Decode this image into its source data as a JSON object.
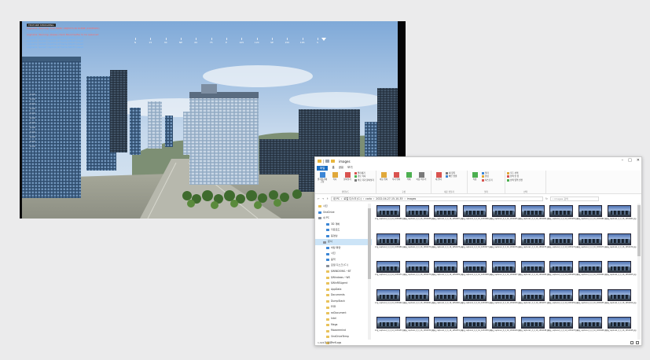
{
  "simulator": {
    "log_header": "TEXTURE STREAMING",
    "log_lines": [
      {
        "text": "LogCarla: Warning: TOO MANY OBJECTS IN SCENE (COMPLEX)",
        "type": "warn"
      },
      {
        "text": "LogRenderer: Grid dataset cache count: 512 (textures 24)",
        "type": "info"
      },
      {
        "text": "LogCarla: Warning: please check Blend buffer to be spawned",
        "type": "warn"
      },
      {
        "text": "LogCarla: Sensor capture at frame 18431 saved",
        "type": "info"
      },
      {
        "text": "LogCarla: Sensor capture at frame 18432 saved",
        "type": "info"
      },
      {
        "text": "LogCarla: Sensor capture at frame 18433 saved",
        "type": "info"
      },
      {
        "text": "LogCarla: Sensor capture at frame 18434 saved",
        "type": "info"
      }
    ],
    "compass_labels": [
      "N",
      "15",
      "30",
      "NE",
      "60",
      "75",
      "E",
      "105",
      "120",
      "SE",
      "150",
      "165",
      "S"
    ],
    "side_values": [
      "0.00",
      "0.00",
      "0.00",
      "0.00",
      "0.00",
      "0.00",
      "0.00",
      "0.00",
      "0.00",
      "0.00",
      "0.00",
      "0.00"
    ],
    "colors": {
      "sky_top": "#7fa9d8",
      "sky_bottom": "#dce8f2",
      "ground": "#8d8f83"
    }
  },
  "explorer": {
    "title": "images",
    "window_controls": [
      "–",
      "□",
      "✕"
    ],
    "ribbon_tabs": [
      "파일",
      "홈",
      "공유",
      "보기"
    ],
    "ribbon_groups": [
      {
        "label": "클립보드",
        "buttons": [
          "즐겨찾기에 고정",
          "복사",
          "붙여넣기"
        ],
        "small": [
          "잘라내기",
          "경로 복사",
          "바로 가기 붙여넣기"
        ]
      },
      {
        "label": "구성",
        "buttons": [
          "이동 위치",
          "복사 위치",
          "삭제",
          "이름 바꾸기"
        ],
        "small": []
      },
      {
        "label": "새로 만들기",
        "buttons": [
          "새 폴더"
        ],
        "small": [
          "새 항목",
          "빠른 연결"
        ]
      },
      {
        "label": "열기",
        "buttons": [
          "속성"
        ],
        "small": [
          "열기",
          "편집",
          "히스토리"
        ]
      },
      {
        "label": "선택",
        "buttons": [],
        "small": [
          "모두 선택",
          "선택 안 함",
          "선택 영역 반전"
        ]
      }
    ],
    "address": {
      "path": [
        "내 PC",
        "로컬 디스크 (C:)",
        "carla",
        "2022-04-27-15-10-33",
        "images"
      ],
      "search_placeholder": "images 검색"
    },
    "nav_items": [
      {
        "label": "사진",
        "icon": "folder",
        "indent": false,
        "selected": false
      },
      {
        "label": "OneDrive",
        "icon": "blue",
        "indent": false,
        "selected": false
      },
      {
        "label": "내 PC",
        "icon": "gray",
        "indent": false,
        "selected": false
      },
      {
        "label": "3D 개체",
        "icon": "blue",
        "indent": true,
        "selected": false
      },
      {
        "label": "다운로드",
        "icon": "blue",
        "indent": true,
        "selected": false
      },
      {
        "label": "동영상",
        "icon": "blue",
        "indent": true,
        "selected": false
      },
      {
        "label": "문서",
        "icon": "gray",
        "indent": true,
        "selected": true
      },
      {
        "label": "바탕 화면",
        "icon": "blue",
        "indent": true,
        "selected": false
      },
      {
        "label": "사진",
        "icon": "blue",
        "indent": true,
        "selected": false
      },
      {
        "label": "음악",
        "icon": "blue",
        "indent": true,
        "selected": false
      },
      {
        "label": "로컬 디스크 (C:)",
        "icon": "gray",
        "indent": true,
        "selected": false
      },
      {
        "label": "$WINDOWS.~BT",
        "icon": "folder",
        "indent": true,
        "selected": false
      },
      {
        "label": "$Windows.~WS",
        "icon": "folder",
        "indent": true,
        "selected": false
      },
      {
        "label": "$WinREAgent",
        "icon": "folder",
        "indent": true,
        "selected": false
      },
      {
        "label": "AppData",
        "icon": "folder",
        "indent": true,
        "selected": false
      },
      {
        "label": "Documents",
        "icon": "folder",
        "indent": true,
        "selected": false
      },
      {
        "label": "DumpStack",
        "icon": "folder",
        "indent": true,
        "selected": false
      },
      {
        "label": "ESD",
        "icon": "folder",
        "indent": true,
        "selected": false
      },
      {
        "label": "ezDocument",
        "icon": "folder",
        "indent": true,
        "selected": false
      },
      {
        "label": "Intel",
        "icon": "folder",
        "indent": true,
        "selected": false
      },
      {
        "label": "Mega",
        "icon": "folder",
        "indent": true,
        "selected": false
      },
      {
        "label": "Mozaremind",
        "icon": "folder",
        "indent": true,
        "selected": false
      },
      {
        "label": "OneDriveTemp",
        "icon": "folder",
        "indent": true,
        "selected": false
      },
      {
        "label": "PerfLogs",
        "icon": "folder",
        "indent": true,
        "selected": false
      }
    ],
    "thumbnails": [
      "img_capture1_0_0_16_1650989.jpg",
      "img_capture1_0_0_16_1650988.jpg",
      "img_capture1_0_0_16_1650987.jpg",
      "img_capture1_0_0_16_1650986.jpg",
      "img_capture1_0_0_16_1650985.jpg",
      "img_capture1_0_0_16_1650984.jpg",
      "img_capture1_0_0_16_1650983.jpg",
      "img_capture1_0_0_16_1650982.jpg",
      "img_capture1_0_0_16_1650981.jpg",
      "img_capture1_0_0_16_1650980.jpg",
      "img_capture1_0_0_16_1650979.jpg",
      "img_capture1_0_0_16_1650978.jpg",
      "img_capture1_0_0_16_1650977.jpg",
      "img_capture1_0_0_16_1650976.jpg",
      "img_capture1_0_0_16_1650975.jpg",
      "img_capture1_0_0_16_1650974.jpg",
      "img_capture1_0_0_16_1650973.jpg",
      "img_capture1_0_0_16_1650972.jpg",
      "img_capture1_0_0_16_1650971.jpg",
      "img_capture1_0_0_16_1650970.jpg",
      "img_capture1_0_0_16_1650969.jpg",
      "img_capture1_0_0_16_1650968.jpg",
      "img_capture1_0_0_16_1650967.jpg",
      "img_capture1_0_0_16_1650966.jpg",
      "img_capture1_0_0_16_1650965.jpg",
      "img_capture1_0_0_16_1650964.jpg",
      "img_capture1_0_0_16_1650963.jpg",
      "img_capture1_0_0_16_1650962.jpg",
      "img_capture1_0_0_16_1650961.jpg",
      "img_capture1_0_0_16_1650960.jpg",
      "img_capture1_0_0_16_1650959.jpg",
      "img_capture1_0_0_16_1650958.jpg",
      "img_capture1_0_0_16_1650957.jpg",
      "img_capture1_0_0_16_1650956.jpg",
      "img_capture1_0_0_16_1650955.jpg",
      "img_capture1_0_0_16_1650954.jpg",
      "img_capture1_0_0_16_1650953.jpg",
      "img_capture1_0_0_16_1650952.jpg",
      "img_capture1_0_0_16_1650951.jpg",
      "img_capture1_0_0_16_1650950.jpg",
      "img_capture1_0_0_16_1650949.jpg",
      "img_capture1_0_0_16_1650948.jpg",
      "img_capture1_0_0_16_1650947.jpg",
      "img_capture1_0_0_16_1650946.jpg",
      "img_capture1_0_0_16_1650945.jpg"
    ],
    "status_text": "1,024개 항목",
    "accent_color": "#1a6fc4"
  }
}
